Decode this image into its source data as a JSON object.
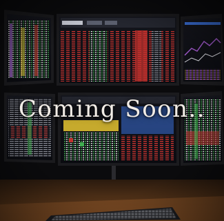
{
  "overlay": {
    "caption": "Coming Soon.."
  },
  "colors": {
    "screen_bezel": "#1b1b1e",
    "screen_bg": "#0c0d12",
    "accent_red": "#c4322e",
    "accent_green": "#3fae4f",
    "accent_yellow": "#e6c531",
    "accent_purple": "#a45bd0",
    "accent_blue": "#3a6fd8",
    "desk_orange": "#7a4a22"
  },
  "scene": {
    "description_icons": [
      "monitor-icon",
      "keyboard-icon"
    ]
  }
}
